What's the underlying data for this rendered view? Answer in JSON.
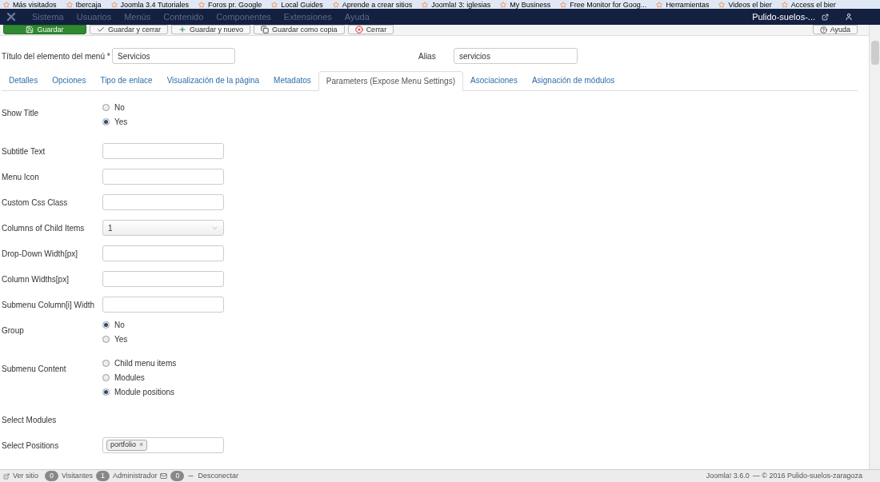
{
  "bookmarks": [
    "Más visitados",
    "Ibercaja",
    "Joomla 3.4 Tutoriales",
    "Foros pr. Google",
    "Local Guides",
    "Aprende a crear sitios",
    "Joomla! 3: iglesias",
    "My Business",
    "Free Monitor for Goog...",
    "Herramientas",
    "Videos el bier",
    "Access el bier"
  ],
  "nav": {
    "menu": [
      "Sistema",
      "Usuarios",
      "Menús",
      "Contenido",
      "Componentes",
      "Extensiones",
      "Ayuda"
    ],
    "site": "Pulido-suelos-..."
  },
  "toolbar": [
    {
      "label": "Guardar",
      "kind": "primary"
    },
    {
      "label": "Guardar y cerrar",
      "kind": "check"
    },
    {
      "label": "Guardar y nuevo",
      "kind": "plus"
    },
    {
      "label": "Guardar como copia",
      "kind": "copy"
    },
    {
      "label": "Cerrar",
      "kind": "close"
    }
  ],
  "help": "Ayuda",
  "title_field": {
    "label": "Título del elemento del menú",
    "required": "*",
    "value": "Servicios"
  },
  "alias_field": {
    "label": "Alias",
    "value": "servicios"
  },
  "tabs": [
    {
      "label": "Detalles",
      "selected": false
    },
    {
      "label": "Opciones",
      "selected": false
    },
    {
      "label": "Tipo de enlace",
      "selected": false
    },
    {
      "label": "Visualización de la página",
      "selected": false
    },
    {
      "label": "Metadatos",
      "selected": false
    },
    {
      "label": "Parameters (Expose Menu Settings)",
      "selected": true
    },
    {
      "label": "Asociaciones",
      "selected": false
    },
    {
      "label": "Asignación de módulos",
      "selected": false
    }
  ],
  "fields": [
    {
      "label": "Show Title",
      "kind": "radio",
      "options": [
        {
          "label": "No",
          "selected": false
        },
        {
          "label": "Yes",
          "selected": true
        }
      ]
    },
    {
      "label": "Subtitle Text",
      "kind": "text"
    },
    {
      "label": "Menu Icon",
      "kind": "text"
    },
    {
      "label": "Custom Css Class",
      "kind": "text"
    },
    {
      "label": "Columns of Child Items",
      "kind": "select",
      "value": "1"
    },
    {
      "label": "Drop-Down Width[px]",
      "kind": "text"
    },
    {
      "label": "Column Widths[px]",
      "kind": "text"
    },
    {
      "label": "Submenu Column[i] Width",
      "kind": "text"
    },
    {
      "label": "Group",
      "kind": "radio",
      "options": [
        {
          "label": "No",
          "selected": true
        },
        {
          "label": "Yes",
          "selected": false
        }
      ]
    },
    {
      "label": "Submenu Content",
      "kind": "radio",
      "options": [
        {
          "label": "Child menu items",
          "selected": false
        },
        {
          "label": "Modules",
          "selected": false
        },
        {
          "label": "Module positions",
          "selected": true
        }
      ]
    },
    {
      "label": "Select Modules",
      "kind": "none"
    },
    {
      "label": "Select Positions",
      "kind": "tags",
      "tags": [
        {
          "label": "portfolio",
          "remove": "×"
        }
      ]
    }
  ],
  "status_bar": {
    "view_site": "Ver sitio",
    "visitors_count": "0",
    "visitors": "Visitantes",
    "admin_count": "1",
    "admin": "Administrador",
    "messages_count": "0",
    "logout": "Desconectar",
    "version": "Joomla! 3.6.0",
    "copyright": "— © 2016 Pulido-suelos-zaragoza"
  }
}
